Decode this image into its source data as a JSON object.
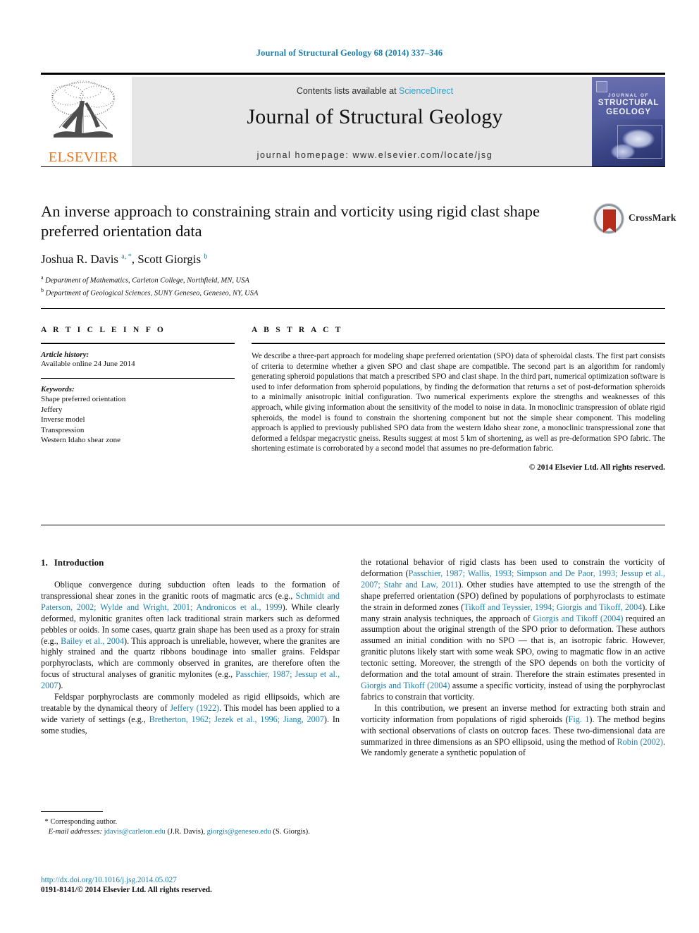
{
  "running_head": "Journal of Structural Geology 68 (2014) 337–346",
  "header": {
    "contents_prefix": "Contents lists available at ",
    "contents_link": "ScienceDirect",
    "journal_title": "Journal of Structural Geology",
    "homepage": "journal homepage: www.elsevier.com/locate/jsg",
    "publisher_logo_text": "ELSEVIER",
    "publisher_logo_icon": "elsevier-tree-icon",
    "cover": {
      "line1": "JOURNAL OF",
      "line2": "STRUCTURAL",
      "line3": "GEOLOGY"
    }
  },
  "article": {
    "title": "An inverse approach to constraining strain and vorticity using rigid clast shape preferred orientation data",
    "crossmark_label": "CrossMark",
    "authors_html": "Joshua R. Davis <sup>a, *</sup>, Scott Giorgis <sup>b</sup>",
    "affiliations": [
      {
        "marker": "a",
        "text": "Department of Mathematics, Carleton College, Northfield, MN, USA"
      },
      {
        "marker": "b",
        "text": "Department of Geological Sciences, SUNY Geneseo, Geneseo, NY, USA"
      }
    ]
  },
  "article_info": {
    "heading": "A R T I C L E   I N F O",
    "history_label": "Article history:",
    "history_value": "Available online 24 June 2014",
    "keywords_label": "Keywords:",
    "keywords": [
      "Shape preferred orientation",
      "Jeffery",
      "Inverse model",
      "Transpression",
      "Western Idaho shear zone"
    ]
  },
  "abstract": {
    "heading": "A B S T R A C T",
    "text": "We describe a three-part approach for modeling shape preferred orientation (SPO) data of spheroidal clasts. The first part consists of criteria to determine whether a given SPO and clast shape are compatible. The second part is an algorithm for randomly generating spheroid populations that match a prescribed SPO and clast shape. In the third part, numerical optimization software is used to infer deformation from spheroid populations, by finding the deformation that returns a set of post-deformation spheroids to a minimally anisotropic initial configuration. Two numerical experiments explore the strengths and weaknesses of this approach, while giving information about the sensitivity of the model to noise in data. In monoclinic transpression of oblate rigid spheroids, the model is found to constrain the shortening component but not the simple shear component. This modeling approach is applied to previously published SPO data from the western Idaho shear zone, a monoclinic transpressional zone that deformed a feldspar megacrystic gneiss. Results suggest at most 5 km of shortening, as well as pre-deformation SPO fabric. The shortening estimate is corroborated by a second model that assumes no pre-deformation fabric.",
    "copyright": "© 2014 Elsevier Ltd. All rights reserved."
  },
  "body": {
    "section_number": "1.",
    "section_title": "Introduction",
    "left_paragraphs": [
      "Oblique convergence during subduction often leads to the formation of transpressional shear zones in the granitic roots of magmatic arcs (e.g., <span class=\"ref\">Schmidt and Paterson, 2002; Wylde and Wright, 2001; Andronicos et al., 1999</span>). While clearly deformed, mylonitic granites often lack traditional strain markers such as deformed pebbles or ooids. In some cases, quartz grain shape has been used as a proxy for strain (e.g., <span class=\"ref\">Bailey et al., 2004</span>). This approach is unreliable, however, where the granites are highly strained and the quartz ribbons boudinage into smaller grains. Feldspar porphyroclasts, which are commonly observed in granites, are therefore often the focus of structural analyses of granitic mylonites (e.g., <span class=\"ref\">Passchier, 1987; Jessup et al., 2007</span>).",
      "Feldspar porphyroclasts are commonly modeled as rigid ellipsoids, which are treatable by the dynamical theory of <span class=\"ref\">Jeffery (1922)</span>. This model has been applied to a wide variety of settings (e.g., <span class=\"ref\">Bretherton, 1962; Jezek et al., 1996; Jiang, 2007</span>). In some studies,"
    ],
    "right_paragraphs": [
      "the rotational behavior of rigid clasts has been used to constrain the vorticity of deformation (<span class=\"ref\">Passchier, 1987; Wallis, 1993; Simpson and De Paor, 1993; Jessup et al., 2007; Stahr and Law, 2011</span>). Other studies have attempted to use the strength of the shape preferred orientation (SPO) defined by populations of porphyroclasts to estimate the strain in deformed zones (<span class=\"ref\">Tikoff and Teyssier, 1994; Giorgis and Tikoff, 2004</span>). Like many strain analysis techniques, the approach of <span class=\"ref\">Giorgis and Tikoff (2004)</span> required an assumption about the original strength of the SPO prior to deformation. These authors assumed an initial condition with no SPO — that is, an isotropic fabric. However, granitic plutons likely start with some weak SPO, owing to magmatic flow in an active tectonic setting. Moreover, the strength of the SPO depends on both the vorticity of deformation and the total amount of strain. Therefore the strain estimates presented in <span class=\"ref\">Giorgis and Tikoff (2004)</span> assume a specific vorticity, instead of using the porphyroclast fabrics to constrain that vorticity.",
      "In this contribution, we present an inverse method for extracting both strain and vorticity information from populations of rigid spheroids (<span class=\"ref\">Fig. 1</span>). The method begins with sectional observations of clasts on outcrop faces. These two-dimensional data are summarized in three dimensions as an SPO ellipsoid, using the method of <span class=\"ref\">Robin (2002)</span>. We randomly generate a synthetic population of"
    ]
  },
  "footnote": {
    "corresponding_marker": "*",
    "corresponding_text": "Corresponding author.",
    "email_label": "E-mail addresses:",
    "email_1": "jdavis@carleton.edu",
    "email_1_owner": "(J.R. Davis),",
    "email_2": "giorgis@geneseo.edu",
    "email_2_owner": "(S. Giorgis)."
  },
  "footer": {
    "doi": "http://dx.doi.org/10.1016/j.jsg.2014.05.027",
    "issn_line": "0191-8141/© 2014 Elsevier Ltd. All rights reserved."
  },
  "colors": {
    "link_blue": "#1a7fae",
    "sciencedirect_blue": "#2aa3d4",
    "elsevier_orange": "#e87722",
    "header_band_gray": "#e6e6e6",
    "crossmark_red": "#b52b1c"
  }
}
